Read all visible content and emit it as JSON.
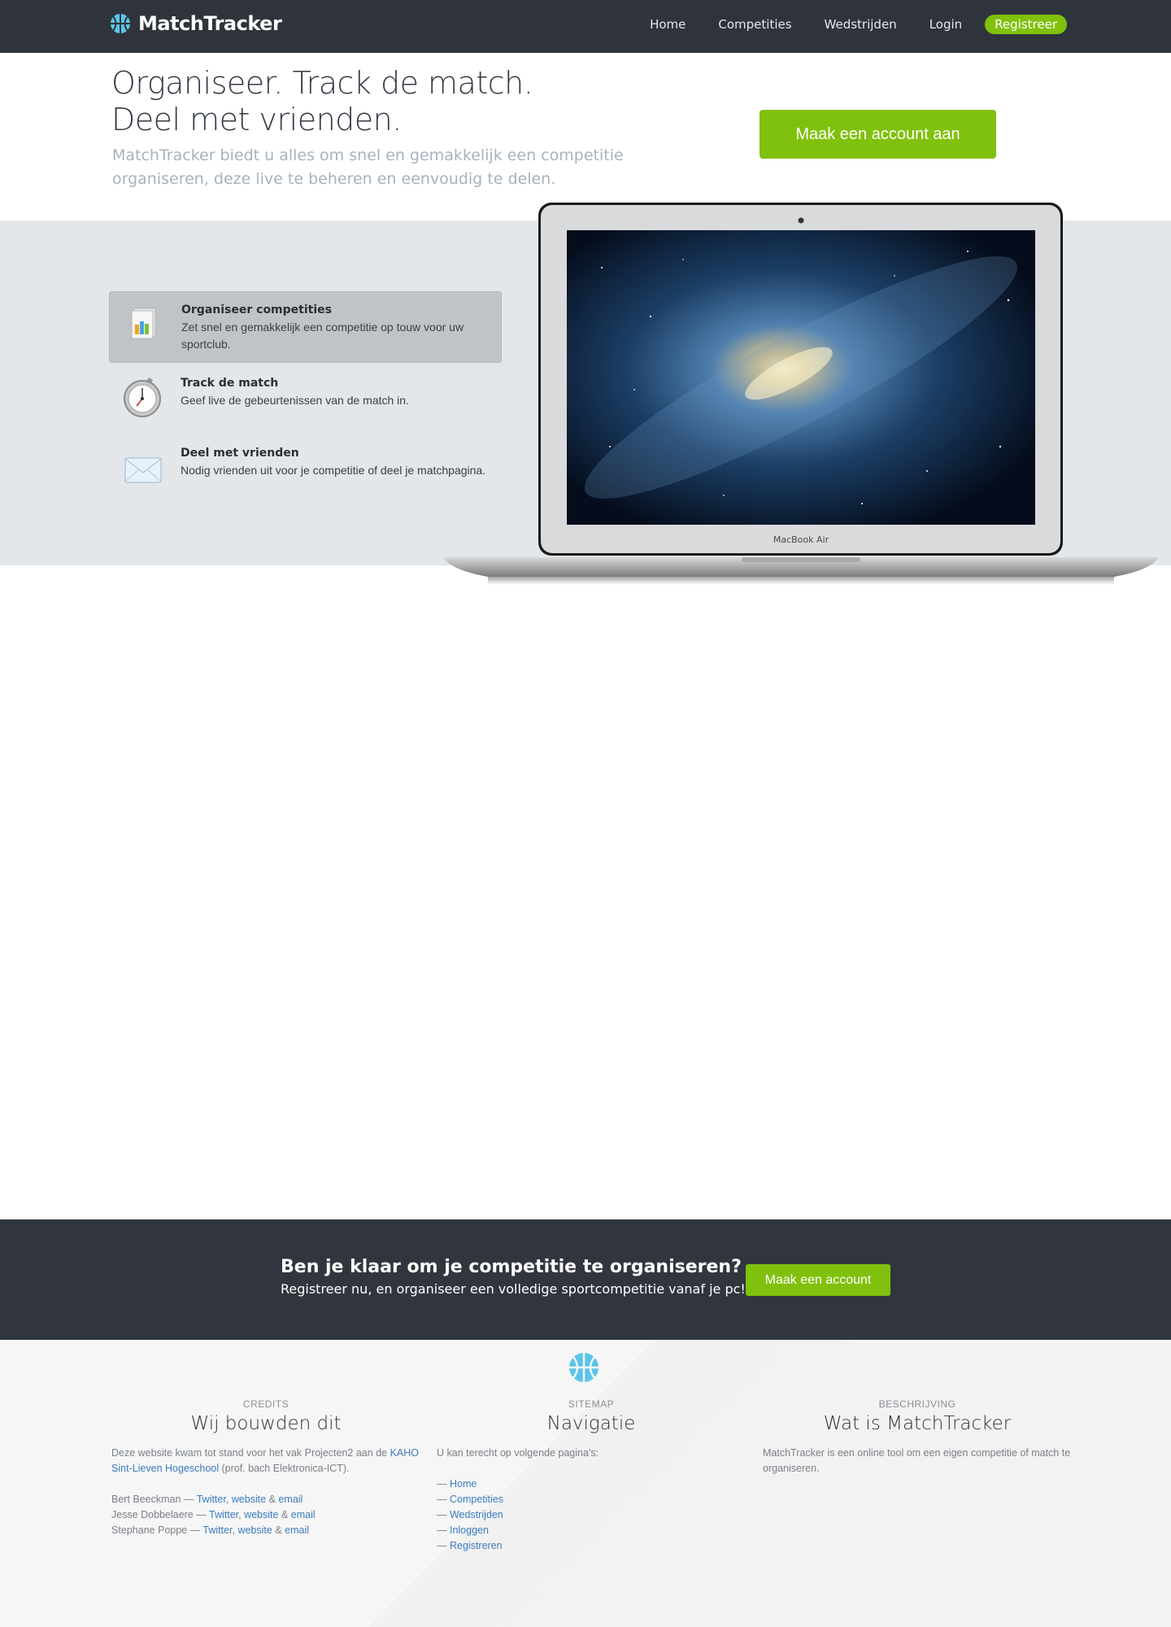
{
  "brand": {
    "name": "MatchTracker",
    "icon": "basketball-icon",
    "accent": "#80c10d"
  },
  "nav": {
    "items": [
      "Home",
      "Competities",
      "Wedstrijden",
      "Login"
    ],
    "register": "Registreer"
  },
  "hero": {
    "title_line1": "Organiseer. Track de match.",
    "title_line2": "Deel met vrienden.",
    "subtitle": "MatchTracker biedt u alles om snel en gemakkelijk een competitie organiseren, deze live te beheren en eenvoudig te delen.",
    "cta": "Maak een account aan"
  },
  "features": [
    {
      "title": "Organiseer competities",
      "text": "Zet snel en gemakkelijk een competitie op touw voor uw sportclub.",
      "icon": "document-chart-icon"
    },
    {
      "title": "Track de match",
      "text": "Geef live de gebeurtenissen van de match in.",
      "icon": "stopwatch-icon"
    },
    {
      "title": "Deel met vrienden",
      "text": "Nodig vrienden uit voor je competitie of deel je matchpagina.",
      "icon": "envelope-icon"
    }
  ],
  "laptop_label": "MacBook Air",
  "cta_band": {
    "title": "Ben je klaar om je competitie te organiseren?",
    "text": "Registreer nu, en organiseer een volledige sportcompetitie vanaf je pc!",
    "button": "Maak een account"
  },
  "footer": {
    "credits": {
      "kicker": "CREDITS",
      "title": "Wij bouwden dit",
      "intro_before": "Deze website kwam tot stand voor het vak Projecten2 aan de ",
      "intro_link": "KAHO Sint-Lieven Hogeschool",
      "intro_after": " (prof. bach Elektronica-ICT).",
      "people": [
        {
          "name": "Bert Beeckman",
          "links": [
            "Twitter",
            "website",
            "email"
          ]
        },
        {
          "name": "Jesse Dobbelaere",
          "links": [
            "Twitter",
            "website",
            "email"
          ]
        },
        {
          "name": "Stephane Poppe",
          "links": [
            "Twitter",
            "website",
            "email"
          ]
        }
      ]
    },
    "sitemap": {
      "kicker": "SITEMAP",
      "title": "Navigatie",
      "intro": "U kan terecht op volgende pagina's:",
      "links": [
        "Home",
        "Competities",
        "Wedstrijden",
        "Inloggen",
        "Registreren"
      ]
    },
    "about": {
      "kicker": "BESCHRIJVING",
      "title": "Wat is MatchTracker",
      "text": "MatchTracker is een online tool om een eigen competitie of match te organiseren."
    }
  }
}
